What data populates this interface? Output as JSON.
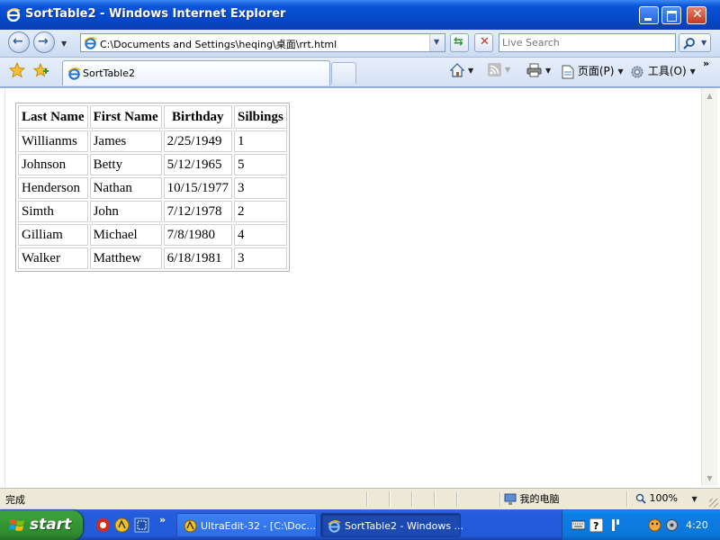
{
  "window": {
    "title": "SortTable2 - Windows Internet Explorer",
    "buttons": [
      "minimize",
      "maximize",
      "close"
    ]
  },
  "address_bar": {
    "url": "C:\\Documents and Settings\\heqing\\桌面\\rrt.html",
    "search_placeholder": "Live Search"
  },
  "tab": {
    "label": "SortTable2"
  },
  "command_bar": {
    "page_label": "页面(P)",
    "tools_label": "工具(O)"
  },
  "table": {
    "headers": [
      "Last Name",
      "First Name",
      "Birthday",
      "Silbings"
    ],
    "rows": [
      [
        "Willianms",
        "James",
        "2/25/1949",
        "1"
      ],
      [
        "Johnson",
        "Betty",
        "5/12/1965",
        "5"
      ],
      [
        "Henderson",
        "Nathan",
        "10/15/1977",
        "3"
      ],
      [
        "Simth",
        "John",
        "7/12/1978",
        "2"
      ],
      [
        "Gilliam",
        "Michael",
        "7/8/1980",
        "4"
      ],
      [
        "Walker",
        "Matthew",
        "6/18/1981",
        "3"
      ]
    ]
  },
  "status_bar": {
    "status": "完成",
    "zone": "我的电脑",
    "zoom": "100%"
  },
  "taskbar": {
    "start_label": "start",
    "tasks": [
      {
        "label": "UltraEdit-32 - [C:\\Doc...",
        "icon": "ultraedit-icon",
        "active": false
      },
      {
        "label": "SortTable2 - Windows ...",
        "icon": "ie-icon",
        "active": true
      }
    ],
    "clock": "4:20"
  },
  "colors": {
    "titlebar": "#0A55D8",
    "taskbar": "#245EDC",
    "start": "#3A9E3A",
    "tray": "#0C7DE4"
  }
}
